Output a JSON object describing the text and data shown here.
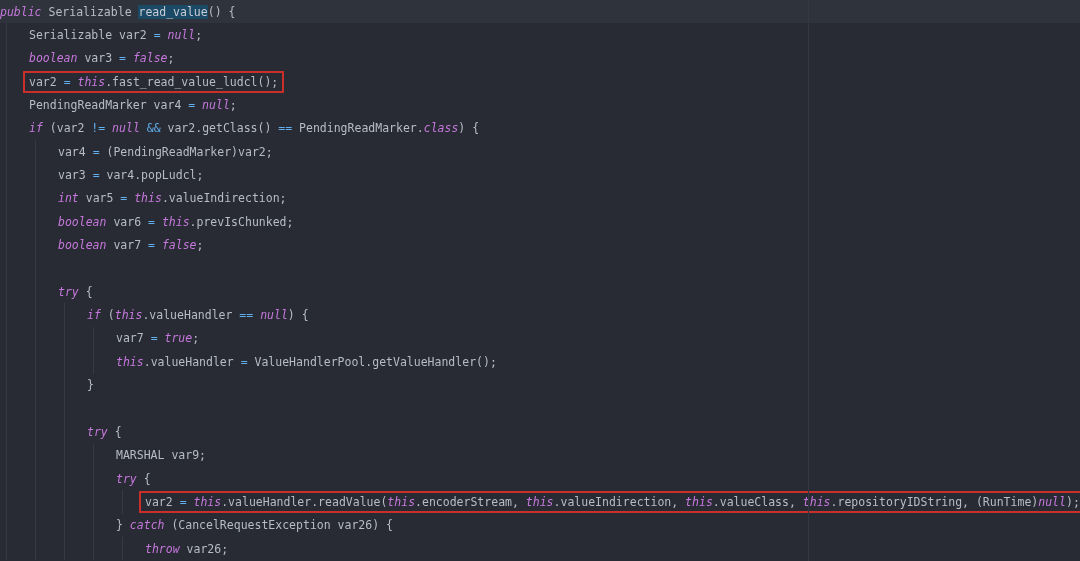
{
  "editor": {
    "lines": [
      {
        "kind": "code",
        "current": true,
        "boxed": false,
        "tokens": [
          {
            "kind": "keyword",
            "text": "public"
          },
          {
            "kind": "text",
            "text": " Serializable "
          },
          {
            "kind": "match",
            "text": "read_value"
          },
          {
            "kind": "text",
            "text": "() {"
          }
        ],
        "children": [
          {
            "kind": "code",
            "boxed": false,
            "tokens": [
              {
                "kind": "text",
                "text": "Serializable var2 "
              },
              {
                "kind": "operator",
                "text": "= "
              },
              {
                "kind": "keyword",
                "text": "null"
              },
              {
                "kind": "text",
                "text": ";"
              }
            ]
          },
          {
            "kind": "code",
            "boxed": false,
            "tokens": [
              {
                "kind": "keyword",
                "text": "boolean"
              },
              {
                "kind": "text",
                "text": " var3 "
              },
              {
                "kind": "operator",
                "text": "= "
              },
              {
                "kind": "keyword",
                "text": "false"
              },
              {
                "kind": "text",
                "text": ";"
              }
            ]
          },
          {
            "kind": "code",
            "boxed": true,
            "tokens": [
              {
                "kind": "text",
                "text": "var2 "
              },
              {
                "kind": "operator",
                "text": "= "
              },
              {
                "kind": "keyword",
                "text": "this"
              },
              {
                "kind": "text",
                "text": ".fast_read_value_ludcl();"
              }
            ]
          },
          {
            "kind": "code",
            "boxed": false,
            "tokens": [
              {
                "kind": "text",
                "text": "PendingReadMarker var4 "
              },
              {
                "kind": "operator",
                "text": "= "
              },
              {
                "kind": "keyword",
                "text": "null"
              },
              {
                "kind": "text",
                "text": ";"
              }
            ]
          },
          {
            "kind": "code",
            "boxed": false,
            "tokens": [
              {
                "kind": "keyword",
                "text": "if"
              },
              {
                "kind": "text",
                "text": " (var2 "
              },
              {
                "kind": "operator",
                "text": "!= "
              },
              {
                "kind": "keyword",
                "text": "null "
              },
              {
                "kind": "operator",
                "text": "&&"
              },
              {
                "kind": "text",
                "text": " var2.getClass() "
              },
              {
                "kind": "operator",
                "text": "=="
              },
              {
                "kind": "text",
                "text": " PendingReadMarker."
              },
              {
                "kind": "keyword",
                "text": "class"
              },
              {
                "kind": "text",
                "text": ") {"
              }
            ],
            "children": [
              {
                "kind": "code",
                "boxed": false,
                "tokens": [
                  {
                    "kind": "text",
                    "text": "var4 "
                  },
                  {
                    "kind": "operator",
                    "text": "="
                  },
                  {
                    "kind": "text",
                    "text": " (PendingReadMarker)var2;"
                  }
                ]
              },
              {
                "kind": "code",
                "boxed": false,
                "tokens": [
                  {
                    "kind": "text",
                    "text": "var3 "
                  },
                  {
                    "kind": "operator",
                    "text": "="
                  },
                  {
                    "kind": "text",
                    "text": " var4.popLudcl;"
                  }
                ]
              },
              {
                "kind": "code",
                "boxed": false,
                "tokens": [
                  {
                    "kind": "keyword",
                    "text": "int"
                  },
                  {
                    "kind": "text",
                    "text": " var5 "
                  },
                  {
                    "kind": "operator",
                    "text": "= "
                  },
                  {
                    "kind": "keyword",
                    "text": "this"
                  },
                  {
                    "kind": "text",
                    "text": ".valueIndirection;"
                  }
                ]
              },
              {
                "kind": "code",
                "boxed": false,
                "tokens": [
                  {
                    "kind": "keyword",
                    "text": "boolean"
                  },
                  {
                    "kind": "text",
                    "text": " var6 "
                  },
                  {
                    "kind": "operator",
                    "text": "= "
                  },
                  {
                    "kind": "keyword",
                    "text": "this"
                  },
                  {
                    "kind": "text",
                    "text": ".prevIsChunked;"
                  }
                ]
              },
              {
                "kind": "code",
                "boxed": false,
                "tokens": [
                  {
                    "kind": "keyword",
                    "text": "boolean"
                  },
                  {
                    "kind": "text",
                    "text": " var7 "
                  },
                  {
                    "kind": "operator",
                    "text": "= "
                  },
                  {
                    "kind": "keyword",
                    "text": "false"
                  },
                  {
                    "kind": "text",
                    "text": ";"
                  }
                ]
              },
              {
                "kind": "blank",
                "boxed": false
              },
              {
                "kind": "code",
                "boxed": false,
                "tokens": [
                  {
                    "kind": "keyword",
                    "text": "try"
                  },
                  {
                    "kind": "text",
                    "text": " {"
                  }
                ],
                "children": [
                  {
                    "kind": "code",
                    "boxed": false,
                    "tokens": [
                      {
                        "kind": "keyword",
                        "text": "if"
                      },
                      {
                        "kind": "text",
                        "text": " ("
                      },
                      {
                        "kind": "keyword",
                        "text": "this"
                      },
                      {
                        "kind": "text",
                        "text": ".valueHandler "
                      },
                      {
                        "kind": "operator",
                        "text": "== "
                      },
                      {
                        "kind": "keyword",
                        "text": "null"
                      },
                      {
                        "kind": "text",
                        "text": ") {"
                      }
                    ],
                    "children": [
                      {
                        "kind": "code",
                        "boxed": false,
                        "tokens": [
                          {
                            "kind": "text",
                            "text": "var7 "
                          },
                          {
                            "kind": "operator",
                            "text": "= "
                          },
                          {
                            "kind": "keyword",
                            "text": "true"
                          },
                          {
                            "kind": "text",
                            "text": ";"
                          }
                        ]
                      },
                      {
                        "kind": "code",
                        "boxed": false,
                        "tokens": [
                          {
                            "kind": "keyword",
                            "text": "this"
                          },
                          {
                            "kind": "text",
                            "text": ".valueHandler "
                          },
                          {
                            "kind": "operator",
                            "text": "="
                          },
                          {
                            "kind": "text",
                            "text": " ValueHandlerPool.getValueHandler();"
                          }
                        ]
                      }
                    ]
                  },
                  {
                    "kind": "code",
                    "boxed": false,
                    "tokens": [
                      {
                        "kind": "text",
                        "text": "}"
                      }
                    ]
                  },
                  {
                    "kind": "blank",
                    "boxed": false
                  },
                  {
                    "kind": "code",
                    "boxed": false,
                    "tokens": [
                      {
                        "kind": "keyword",
                        "text": "try"
                      },
                      {
                        "kind": "text",
                        "text": " {"
                      }
                    ],
                    "children": [
                      {
                        "kind": "code",
                        "boxed": false,
                        "tokens": [
                          {
                            "kind": "text",
                            "text": "MARSHAL var9;"
                          }
                        ]
                      },
                      {
                        "kind": "code",
                        "boxed": false,
                        "tokens": [
                          {
                            "kind": "keyword",
                            "text": "try"
                          },
                          {
                            "kind": "text",
                            "text": " {"
                          }
                        ],
                        "children": [
                          {
                            "kind": "code",
                            "boxed": true,
                            "tokens": [
                              {
                                "kind": "text",
                                "text": "var2 "
                              },
                              {
                                "kind": "operator",
                                "text": "= "
                              },
                              {
                                "kind": "keyword",
                                "text": "this"
                              },
                              {
                                "kind": "text",
                                "text": ".valueHandler.readValue("
                              },
                              {
                                "kind": "keyword",
                                "text": "this"
                              },
                              {
                                "kind": "text",
                                "text": ".encoderStream, "
                              },
                              {
                                "kind": "keyword",
                                "text": "this"
                              },
                              {
                                "kind": "text",
                                "text": ".valueIndirection, "
                              },
                              {
                                "kind": "keyword",
                                "text": "this"
                              },
                              {
                                "kind": "text",
                                "text": ".valueClass, "
                              },
                              {
                                "kind": "keyword",
                                "text": "this"
                              },
                              {
                                "kind": "text",
                                "text": ".repositoryIDString, (RunTime)"
                              },
                              {
                                "kind": "keyword",
                                "text": "null"
                              },
                              {
                                "kind": "text",
                                "text": ");"
                              }
                            ]
                          }
                        ]
                      },
                      {
                        "kind": "code",
                        "boxed": false,
                        "tokens": [
                          {
                            "kind": "text",
                            "text": "} "
                          },
                          {
                            "kind": "keyword",
                            "text": "catch"
                          },
                          {
                            "kind": "text",
                            "text": " (CancelRequestException var26) {"
                          }
                        ],
                        "children": [
                          {
                            "kind": "code",
                            "boxed": false,
                            "tokens": [
                              {
                                "kind": "keyword",
                                "text": "throw"
                              },
                              {
                                "kind": "text",
                                "text": " var26;"
                              }
                            ]
                          }
                        ]
                      }
                    ]
                  }
                ]
              }
            ]
          }
        ]
      }
    ]
  }
}
